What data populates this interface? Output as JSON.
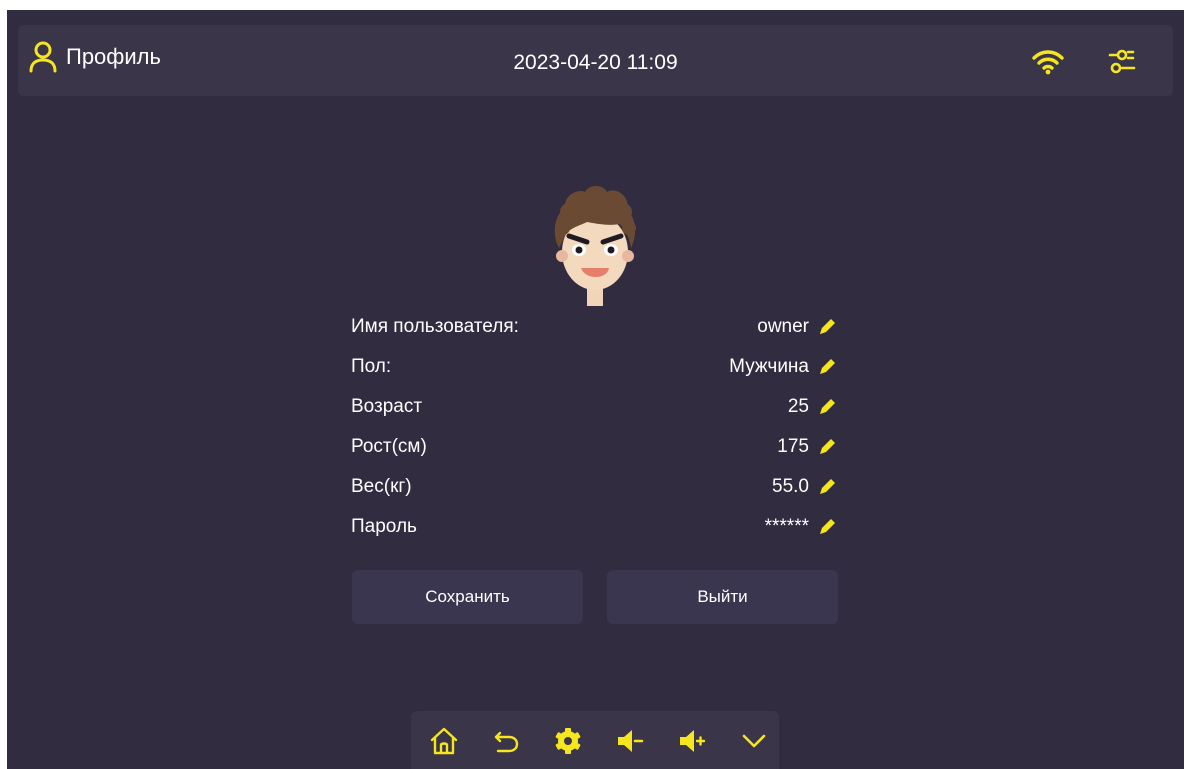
{
  "header": {
    "title": "Профиль",
    "datetime": "2023-04-20 11:09",
    "icons": [
      "user-icon",
      "wifi-icon",
      "sliders-icon"
    ]
  },
  "profile": {
    "fields": [
      {
        "label": "Имя пользователя:",
        "value": "owner"
      },
      {
        "label": "Пол:",
        "value": "Мужчина"
      },
      {
        "label": "Возраст",
        "value": "25"
      },
      {
        "label": "Рост(см)",
        "value": "175"
      },
      {
        "label": "Вес(кг)",
        "value": "55.0"
      },
      {
        "label": "Пароль",
        "value": "******"
      }
    ]
  },
  "buttons": {
    "save_label": "Сохранить",
    "exit_label": "Выйти"
  },
  "bottom_nav": {
    "icons": [
      "home-icon",
      "back-icon",
      "gear-icon",
      "volume-down-icon",
      "volume-up-icon",
      "chevron-down-icon"
    ]
  },
  "colors": {
    "background": "#312c40",
    "panel": "#3a3549",
    "button": "#3b3650",
    "accent": "#f5e61e",
    "text": "#ffffff"
  }
}
